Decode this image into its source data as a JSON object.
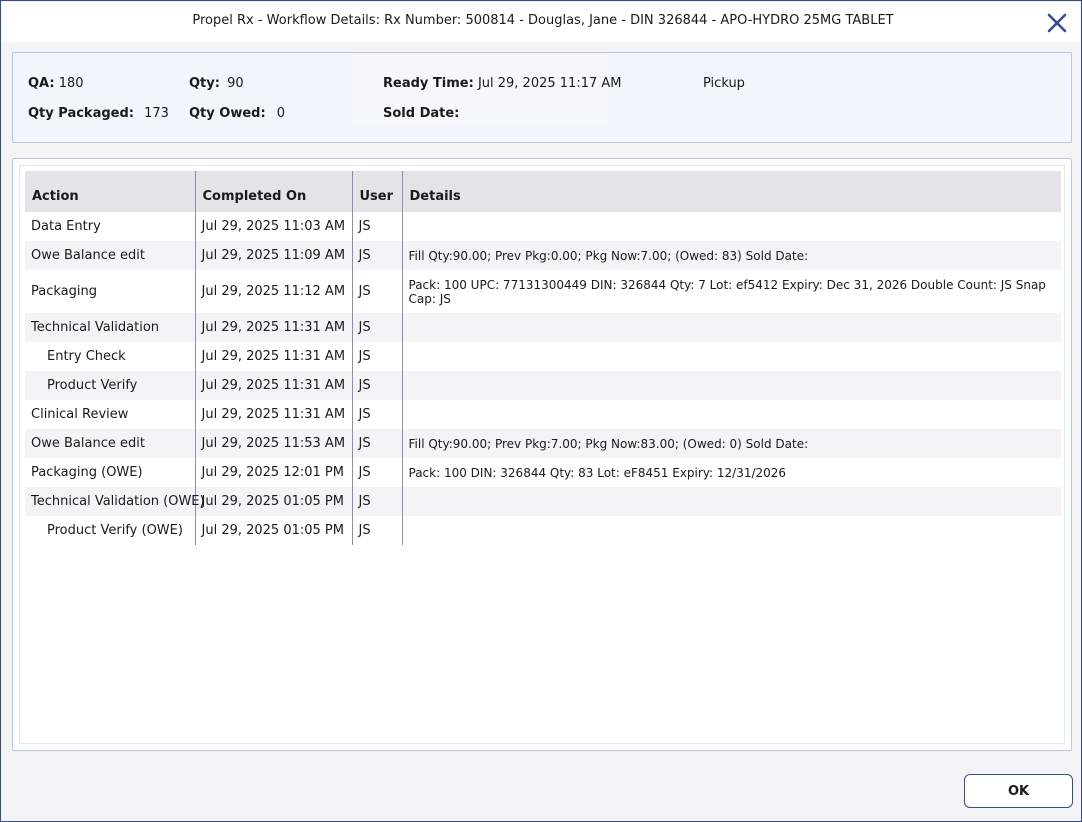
{
  "window": {
    "title": "Propel Rx - Workflow Details: Rx Number: 500814 - Douglas, Jane - DIN 326844 - APO-HYDRO 25MG TABLET"
  },
  "info": {
    "qa_label": "QA:",
    "qa_value": "180",
    "qty_label": "Qty:",
    "qty_value": "90",
    "ready_time_label": "Ready Time:",
    "ready_time_value": "Jul 29, 2025 11:17 AM",
    "pickup_label": "Pickup",
    "qty_packaged_label": "Qty Packaged:",
    "qty_packaged_value": "173",
    "qty_owed_label": "Qty Owed:",
    "qty_owed_value": "0",
    "sold_date_label": "Sold Date:",
    "sold_date_value": ""
  },
  "grid": {
    "columns": {
      "action": "Action",
      "completed_on": "Completed On",
      "user": "User",
      "details": "Details"
    },
    "rows": [
      {
        "action": "Data Entry",
        "completed_on": "Jul 29, 2025 11:03 AM",
        "user": "JS",
        "details": ""
      },
      {
        "action": "Owe Balance edit",
        "completed_on": "Jul 29, 2025 11:09 AM",
        "user": "JS",
        "details": "Fill Qty:90.00; Prev Pkg:0.00; Pkg Now:7.00; (Owed: 83) Sold Date:"
      },
      {
        "action": "Packaging",
        "completed_on": "Jul 29, 2025 11:12 AM",
        "user": "JS",
        "details": "Pack: 100  UPC: 77131300449  DIN: 326844  Qty: 7  Lot: ef5412  Expiry: Dec 31, 2026   Double Count: JS  Snap Cap: JS"
      },
      {
        "action": "Technical Validation",
        "completed_on": "Jul 29, 2025 11:31 AM",
        "user": "JS",
        "details": ""
      },
      {
        "action": "Entry Check",
        "completed_on": "Jul 29, 2025 11:31 AM",
        "user": "JS",
        "details": ""
      },
      {
        "action": "Product Verify",
        "completed_on": "Jul 29, 2025 11:31 AM",
        "user": "JS",
        "details": ""
      },
      {
        "action": "Clinical Review",
        "completed_on": "Jul 29, 2025 11:31 AM",
        "user": "JS",
        "details": ""
      },
      {
        "action": "Owe Balance edit",
        "completed_on": "Jul 29, 2025 11:53 AM",
        "user": "JS",
        "details": "Fill Qty:90.00; Prev Pkg:7.00; Pkg Now:83.00; (Owed: 0) Sold Date:"
      },
      {
        "action": "Packaging (OWE)",
        "completed_on": "Jul 29, 2025 12:01 PM",
        "user": "JS",
        "details": "Pack: 100  DIN: 326844  Qty: 83  Lot: eF8451  Expiry: 12/31/2026"
      },
      {
        "action": "Technical Validation (OWE)",
        "completed_on": "Jul 29, 2025 01:05 PM",
        "user": "JS",
        "details": ""
      },
      {
        "action": "Product Verify (OWE)",
        "completed_on": "Jul 29, 2025 01:05 PM",
        "user": "JS",
        "details": ""
      }
    ]
  },
  "footer": {
    "ok_label": "OK"
  },
  "icons": {
    "close": "close-icon"
  },
  "colors": {
    "accent": "#3a4a8c",
    "header_bg": "#e3e3e8",
    "panel_bg": "#f1f6fc"
  }
}
